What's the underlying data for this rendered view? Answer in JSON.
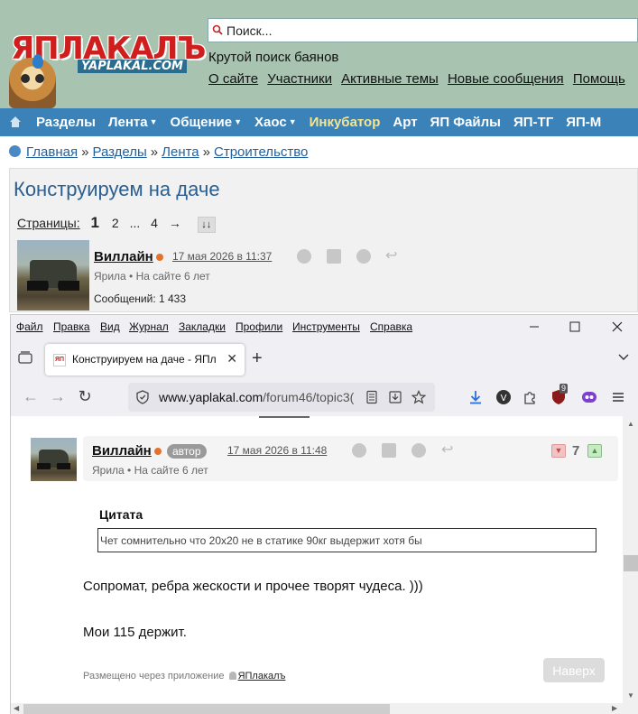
{
  "site": {
    "logo_text": "ЯПЛАКАЛЪ",
    "logo_sub": "YAPLAKAL.COM",
    "search_placeholder": "Поиск...",
    "tagline": "Крутой поиск баянов",
    "top_links": [
      "О сайте",
      "Участники",
      "Активные темы",
      "Новые сообщения",
      "Помощь"
    ]
  },
  "nav": {
    "items": [
      {
        "label": "Разделы",
        "dropdown": false,
        "accent": false
      },
      {
        "label": "Лента",
        "dropdown": true,
        "accent": false
      },
      {
        "label": "Общение",
        "dropdown": true,
        "accent": false
      },
      {
        "label": "Хаос",
        "dropdown": true,
        "accent": false
      },
      {
        "label": "Инкубатор",
        "dropdown": false,
        "accent": true
      },
      {
        "label": "Арт",
        "dropdown": false,
        "accent": false
      },
      {
        "label": "ЯП Файлы",
        "dropdown": false,
        "accent": false
      },
      {
        "label": "ЯП-ТГ",
        "dropdown": false,
        "accent": false
      },
      {
        "label": "ЯП-М",
        "dropdown": false,
        "accent": false
      }
    ],
    "accent_color": "#f6e58d",
    "bar_color": "#3b82b9"
  },
  "breadcrumbs": [
    "Главная",
    "Разделы",
    "Лента",
    "Строительство"
  ],
  "topic": {
    "title": "Конструируем на даче",
    "pages_label": "Страницы:",
    "current_page": "1",
    "pages": [
      "2",
      "...",
      "4",
      "→"
    ],
    "jump_icon": "↓↓"
  },
  "bg_post": {
    "author": "Виллайн",
    "date": "17 мая 2026 в 11:37",
    "meta": "Ярила  •  На сайте 6 лет",
    "messages": "Сообщений: 1 433"
  },
  "browser": {
    "menu": [
      "Файл",
      "Правка",
      "Вид",
      "Журнал",
      "Закладки",
      "Профили",
      "Инструменты",
      "Справка"
    ],
    "tab_title": "Конструируем на даче - ЯПлакалъ",
    "url_host": "www.yaplakal.com",
    "url_path": "/forum46/topic3(",
    "ext_badge": "9"
  },
  "post": {
    "author": "Виллайн",
    "role": "автор",
    "date": "17 мая 2026 в 11:48",
    "meta": "Ярила  •  На сайте 6 лет",
    "rating": "7",
    "quote_label": "Цитата",
    "quote_text": "Чет сомнительно что 20х20 не в статике 90кг выдержит хотя бы",
    "text1": "Сопромат, ребра жескости и прочее творят чудеса. )))",
    "text2": "Мои 115 держит.",
    "via_prefix": "Размещено через приложение",
    "via_app": "ЯПлакалъ",
    "to_top": "Наверх"
  }
}
